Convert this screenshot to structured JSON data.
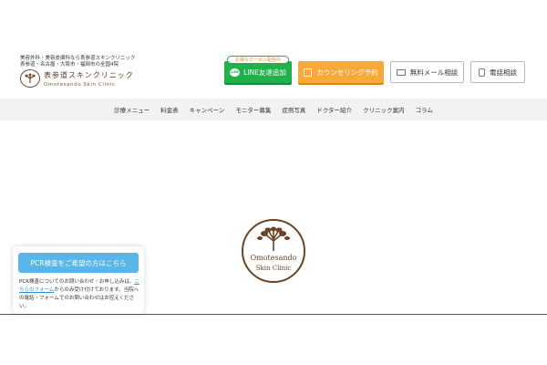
{
  "header": {
    "tagline_line1": "美容外科・美容皮膚科なら表参道スキンクリニック",
    "tagline_line2": "表参道・名古屋・大阪市・福岡市の全国4院",
    "logo_ja": "表参道スキンクリニック",
    "logo_en": "Omotesando Skin Clinic"
  },
  "buttons": {
    "line_badge": "お得なクーポン配信中",
    "line_icon": "LINE",
    "line_label": "LINE友達追加",
    "counsel_label": "カウンセリング予約",
    "mail_label": "無料メール相談",
    "tel_label": "電話相談"
  },
  "nav": {
    "items": [
      "診療メニュー",
      "料金表",
      "キャンペーン",
      "モニター募集",
      "症例写真",
      "ドクター紹介",
      "クリニック案内",
      "コラム"
    ]
  },
  "center_logo": {
    "line1": "Omotesando",
    "line2": "Skin Clinic"
  },
  "pcr": {
    "button_label": "PCR検査をご希望の方はこちら",
    "text_before": "PCR検査についてのお問い合わせ・お申し込みは、",
    "link_text": "こちらのフォーム",
    "text_after": "からのみ受け付けております。当院への電話・フォームでのお問い合わせはお控えください。"
  },
  "colors": {
    "line_green": "#20b14b",
    "counsel_orange": "#f7a93a",
    "pcr_blue": "#5ab6e8",
    "brand_brown": "#6d4326"
  }
}
